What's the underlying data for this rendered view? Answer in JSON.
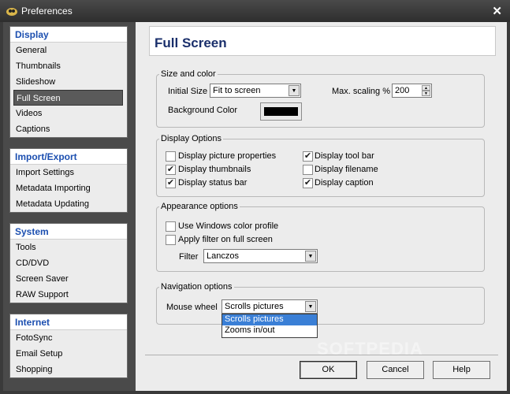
{
  "window": {
    "title": "Preferences",
    "close_symbol": "✕"
  },
  "sidebar": {
    "sections": [
      {
        "head": "Display",
        "items": [
          "General",
          "Thumbnails",
          "Slideshow",
          "Full Screen",
          "Videos",
          "Captions"
        ]
      },
      {
        "head": "Import/Export",
        "items": [
          "Import Settings",
          "Metadata Importing",
          "Metadata Updating"
        ]
      },
      {
        "head": "System",
        "items": [
          "Tools",
          "CD/DVD",
          "Screen Saver",
          "RAW Support"
        ]
      },
      {
        "head": "Internet",
        "items": [
          "FotoSync",
          "Email Setup",
          "Shopping"
        ]
      }
    ],
    "selected": "Full Screen"
  },
  "page": {
    "title": "Full Screen"
  },
  "size_color": {
    "legend": "Size and color",
    "initial_size_label": "Initial Size",
    "initial_size_value": "Fit to screen",
    "max_scaling_label": "Max. scaling %",
    "max_scaling_value": "200",
    "background_color_label": "Background Color",
    "background_color": "#000000"
  },
  "display_options": {
    "legend": "Display Options",
    "left": [
      {
        "label": "Display picture properties",
        "checked": false
      },
      {
        "label": "Display thumbnails",
        "checked": true
      },
      {
        "label": "Display status bar",
        "checked": true
      }
    ],
    "right": [
      {
        "label": "Display tool bar",
        "checked": true
      },
      {
        "label": "Display filename",
        "checked": false
      },
      {
        "label": "Display caption",
        "checked": true
      }
    ]
  },
  "appearance": {
    "legend": "Appearance options",
    "use_windows_profile": {
      "label": "Use Windows color profile",
      "checked": false
    },
    "apply_filter": {
      "label": "Apply filter on full screen",
      "checked": false
    },
    "filter_label": "Filter",
    "filter_value": "Lanczos"
  },
  "navigation": {
    "legend": "Navigation options",
    "mouse_wheel_label": "Mouse wheel",
    "mouse_wheel_value": "Scrolls pictures",
    "options": [
      "Scrolls pictures",
      "Zooms in/out"
    ],
    "highlighted": "Scrolls pictures"
  },
  "buttons": {
    "ok": "OK",
    "cancel": "Cancel",
    "help": "Help"
  },
  "watermark": "SOFTPEDIA",
  "colors": {
    "accent": "#1c4fb0",
    "title_blue": "#1a2f6b",
    "highlight": "#3a7fd6"
  }
}
